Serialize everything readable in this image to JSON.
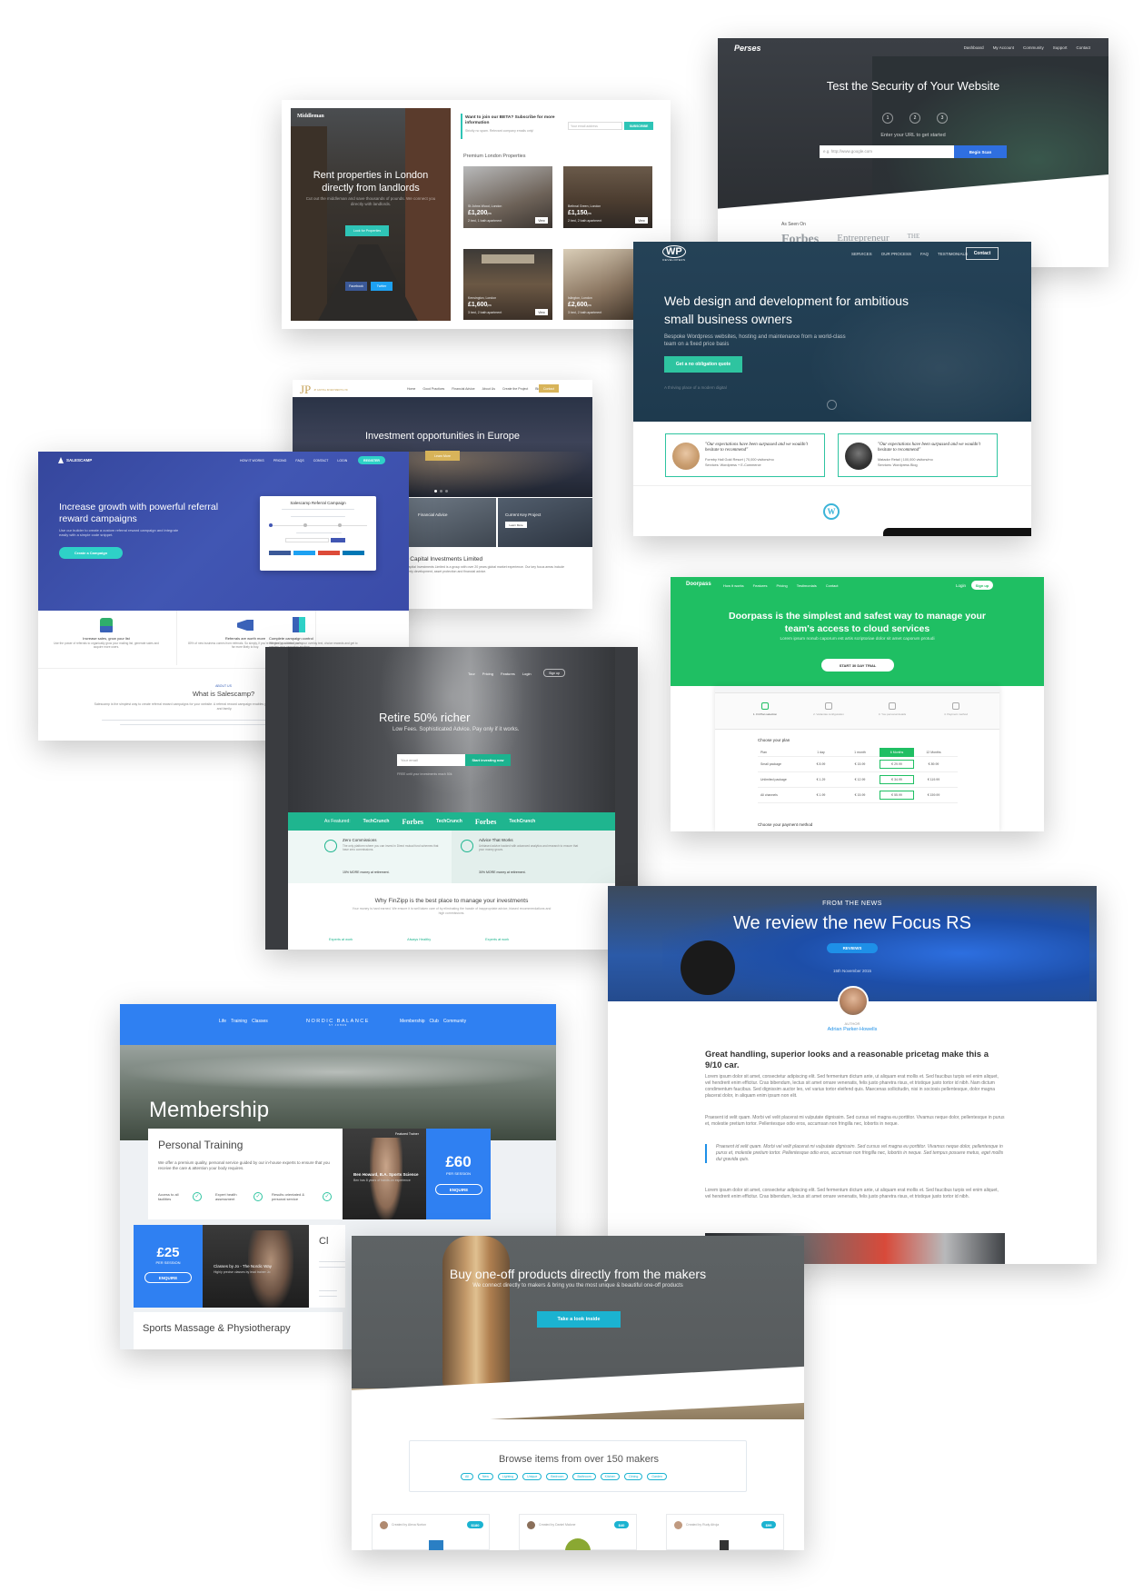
{
  "perses": {
    "logo": "Perses",
    "nav": [
      "Dashboard",
      "My Account",
      "Community",
      "Support",
      "Contact"
    ],
    "hero_title": "Test the Security of Your Website",
    "steps": [
      "1",
      "2",
      "3"
    ],
    "sub": "Enter your URL to get started",
    "url_placeholder": "e.g. http://www.google.com",
    "cta": "Begin Scan",
    "as_seen_on": "As Seen On",
    "press": [
      "Forbes",
      "Entrepreneur",
      "THE"
    ]
  },
  "middleman": {
    "brand": "Middleman",
    "hero_title": "Rent properties in London directly from landlords",
    "hero_sub": "Cut out the middleman and save thousands of pounds. We connect you directly with landlords.",
    "cta": "Look for Properties",
    "social": [
      "Facebook",
      "Twitter"
    ],
    "beta_title": "Want to join our BETA? Subscribe for more information",
    "beta_sub": "Strictly no spam. Relevant company emails only!",
    "email_placeholder": "Your email address",
    "subscribe": "SUBSCRIBE",
    "section_title": "Premium London Properties",
    "properties": [
      {
        "area": "St Johns Wood, London",
        "price": "£1,200",
        "per": "pw",
        "beds": "2 bed, 1 bath apartment",
        "btn": "View"
      },
      {
        "area": "Bethnal Green, London",
        "price": "£1,150",
        "per": "pw",
        "beds": "2 bed, 2 bath apartment",
        "btn": "View"
      },
      {
        "area": "Kensington, London",
        "price": "£1,600",
        "per": "pw",
        "beds": "3 bed, 2 bath apartment",
        "btn": "View"
      },
      {
        "area": "Islington, London",
        "price": "£2,600",
        "per": "pw",
        "beds": "3 bed, 2 bath apartment",
        "btn": "View"
      }
    ]
  },
  "wp": {
    "logo": "WP",
    "logo_sub": "DEVELOPERS",
    "nav": [
      "SERVICES",
      "OUR PROCESS",
      "FAQ",
      "TESTIMONIALS"
    ],
    "contact": "Contact",
    "hero_title": "Web design and development for ambitious small business owners",
    "hero_sub": "Bespoke Wordpress websites, hosting and maintenance from a world-class team on a fixed price basis",
    "cta": "Get a no obligation quote",
    "note": "A thriving place of a modern digital",
    "testimonials": [
      {
        "quote": "\"Our expectations have been surpassed and we wouldn't hesitate to recommend\"",
        "who": "Formby Hall Gold Resort | 70,000 visitors/mo",
        "service": "Services: Wordpress + E-Commerce"
      },
      {
        "quote": "\"Our expectations have been surpassed and we wouldn't hesitate to recommend\"",
        "who": "Matador Retail | 100,000 visitors/mo",
        "service": "Services: Wordpress Blog"
      }
    ],
    "wp_icon": "wordpress-icon"
  },
  "jp": {
    "logo": "JP",
    "logo_sub": "JP CAPITAL INVESTMENTS LTD",
    "nav": [
      "Home",
      "Good Practices",
      "Financial Advice",
      "About Us",
      "Create the Project",
      "Blog"
    ],
    "nav_btn": "Contact",
    "hero_title": "Investment opportunities in Europe",
    "hero_btn": "Learn More",
    "tiles": [
      {
        "title": "Financial Advice",
        "btn": "Learn More"
      },
      {
        "title": "Current Key Project",
        "btn": "Learn More"
      }
    ],
    "company": "JP Capital Investments Limited",
    "company_text": "JP Capital Investments Limited is a group with over 20 years global market experience. Our key focus areas include property development, asset protection and financial advice."
  },
  "salescamp": {
    "logo": "SALESCAMP",
    "nav": [
      "HOW IT WORKS",
      "PRICING",
      "FAQS",
      "CONTACT",
      "LOGIN"
    ],
    "nav_btn": "REGISTER",
    "hero_title": "Increase growth with powerful referral reward campaigns",
    "hero_sub": "Use our builder to create a custom referral reward campaign and integrate easily with a simple code snippet.",
    "cta": "Create a Campaign",
    "modal_title": "Salescamp Referral Campaign",
    "features": [
      {
        "title": "Increase sales, grow your list",
        "text": "Use the power of referrals to organically grow your mailing list, generate sales and acquire more users."
      },
      {
        "title": "Referrals are worth more",
        "text": "80% of new business comes from referrals. So simply, if you're referred by a friend you're far more likely to buy."
      },
      {
        "title": "Complete campaign control",
        "text": "We give you control over your overlay text, choice rewards and get to preview your campaign anytime."
      }
    ],
    "about_label": "ABOUT US",
    "about_title": "What is Salescamp?",
    "about_text": "Salescamp is the simplest way to create referral reward campaigns for your website. A referral reward campaign enables your users to earn rewards by sharing their link with their friends and family."
  },
  "doorpass": {
    "logo": "Doorpass",
    "nav": [
      "How it works",
      "Features",
      "Pricing",
      "Testimonials",
      "Contact"
    ],
    "login": "Login",
    "signup": "Sign up",
    "hero_title": "Doorpass is the simplest and safest way to manage your team's access to cloud services",
    "hero_sub": "Lorem ipsum nonub caporum est artis scriptoriae dolor sit amet caporum protudi",
    "cta": "START 30 DAY TRIAL",
    "steps": [
      "1. Fit Plan selection",
      "2. Variantas configuration",
      "3. You personal details",
      "4. Payment method"
    ],
    "choose_plan": "Choose your plan",
    "table_headers": [
      "Plan",
      "1 day",
      "1 month",
      "6 Months",
      "12 Months"
    ],
    "rows": [
      {
        "name": "Small package",
        "values": [
          "€ 8.99",
          "€ 15.99",
          "€ 29.99",
          "€ 89.99"
        ]
      },
      {
        "name": "Unlimited package",
        "values": [
          "€ 1.29",
          "€ 12.99",
          "€ 34.99",
          "€ 119.99"
        ]
      },
      {
        "name": "All channels",
        "values": [
          "€ 1.99",
          "€ 15.99",
          "€ 55.99",
          "€ 159.99"
        ]
      }
    ],
    "choose_payment": "Choose your payment method"
  },
  "finzipp": {
    "nav": [
      "Tour",
      "Pricing",
      "Features",
      "Login"
    ],
    "nav_btn": "Sign up",
    "hero_title": "Retire 50% richer",
    "hero_sub": "Low Fees. Sophisticated Advice. Pay only if it works.",
    "email_placeholder": "Your email",
    "cta": "Start investing now",
    "fine": "FREE until your investments reach 50k",
    "featured_label": "As Featured:",
    "press": [
      "TechCrunch",
      "Forbes",
      "TechCrunch",
      "Forbes",
      "TechCrunch"
    ],
    "benefits": [
      {
        "title": "Zero Commissions",
        "text": "The only platform where you can invest in Direct mutual fund schemes that have zero commissions.",
        "stat": "15% MORE money at retirement."
      },
      {
        "title": "Advice That Works",
        "text": "Unbiased advice backed with advanced analytics and research to ensure that your money grows.",
        "stat": "30% MORE money at retirement."
      }
    ],
    "why_title": "Why FinZipp is the best place to manage your investments",
    "why_text": "Your money is hard earned. We ensure it is well taken care of by eliminating the hassle of inappropriate advice, biased recommendations and high commissions.",
    "pillars": [
      "Experts at work",
      "Always Healthy",
      "Experts at work"
    ]
  },
  "focus": {
    "kicker": "FROM THE NEWS",
    "title": "We review the new Focus RS",
    "tag": "REVIEWS",
    "date": "15th November 2015",
    "author_label": "AUTHOR",
    "author": "Adrian Parker-Howells",
    "headline": "Great handling, superior looks and a reasonable pricetag make this a 9/10 car.",
    "p1": "Lorem ipsum dolor sit amet, consectetur adipiscing elit. Sed fermentum dictum ante, ut aliquam erat mollis et. Sed faucibus turpis vel enim aliquet, vel hendrerit enim efficitur. Cras bibendum, lectus sit amet ornare venenatis, felis justo pharetra risus, et tristique justo tortor id nibh. Nam dictum condimentum faucibus. Sed dignissim auctor leo, vel varius tortor eleifend quis. Maecenas sollicitudin, nisi in sociosis pellentesque, dolor magna placerat dolor, in aliquam enim ipsum non elit.",
    "p2": "Praesent id velit quam. Morbi vel velit placerat mi vulputate dignissim. Sed cursus vel magna eu porttitor. Vivamus neque dolor, pellentesque in purus et, molestie pretium tortor. Pellentesque odio eros, accumsan non fringilla nec, lobortis in neque.",
    "quote": "Praesent id velit quam. Morbi vel velit placerat mi vulputate dignissim. Sed cursus vel magna eu porttitor. Vivamus neque dolor, pellentesque in purus et, molestie pretium tortor. Pellentesque odio eros, accumsan non fringilla nec, lobortis in neque. Sed tempus posuere metus, eget mollis dui gravida quis.",
    "p3": "Lorem ipsum dolor sit amet, consectetur adipiscing elit. Sed fermentum dictum ante, ut aliquam erat mollis et. Sed faucibus turpis vel enim aliquet, vel hendrerit enim efficitur. Cras bibendum, lectus sit amet ornare venenatis, felis justo pharetra risus, et tristique justo tortor id nibh."
  },
  "nordic": {
    "nav_left": [
      "Life",
      "Training",
      "Classes"
    ],
    "logo": "NORDIC BALANCE",
    "logo_sub": "ST JOHNS",
    "nav_right": [
      "Membership",
      "Club",
      "Community"
    ],
    "hero_title": "Membership",
    "pt_title": "Personal Training",
    "pt_text": "We offer a premium quality, personal service guided by our in-house experts to ensure that you receive the care & attention your body requires.",
    "pt_checks": [
      "Access to all facilities",
      "Expert health assessment",
      "Results orientated & personal service"
    ],
    "trainer_badge": "Featured Trainer",
    "trainer_name": "Ben Howard, B.A. Sports Science",
    "trainer_sub": "Ben has 8 years of hands-on experience",
    "price1": "£60",
    "per1": "PER SESSION",
    "enquire1": "ENQUIRE",
    "price2": "£25",
    "per2": "PER SESSION",
    "enquire2": "ENQUIRE",
    "class_name": "Classes by Jo - The Nordic Way",
    "class_sub": "Highly precise classes by lead trainer Jo",
    "class_title_fragment": "Cl",
    "massage": "Sports Massage & Physiotherapy"
  },
  "makers": {
    "hero_title": "Buy one-off products directly from the makers",
    "hero_sub": "We connect directly to makers & bring you the most unique & beautiful one-off products",
    "cta": "Take a look inside",
    "browse": "Browse items from over 150 makers",
    "tags": [
      "All",
      "New",
      "Lighting",
      "Unique",
      "Bedroom",
      "Bathroom",
      "Kitchen",
      "Dining",
      "Garden"
    ],
    "products": [
      {
        "maker": "Created by Alexa Norton",
        "price": "$180"
      },
      {
        "maker": "Created by Daniel Malone",
        "price": "$40"
      },
      {
        "maker": "Created by Rudy Afroja",
        "price": "$99"
      }
    ]
  }
}
